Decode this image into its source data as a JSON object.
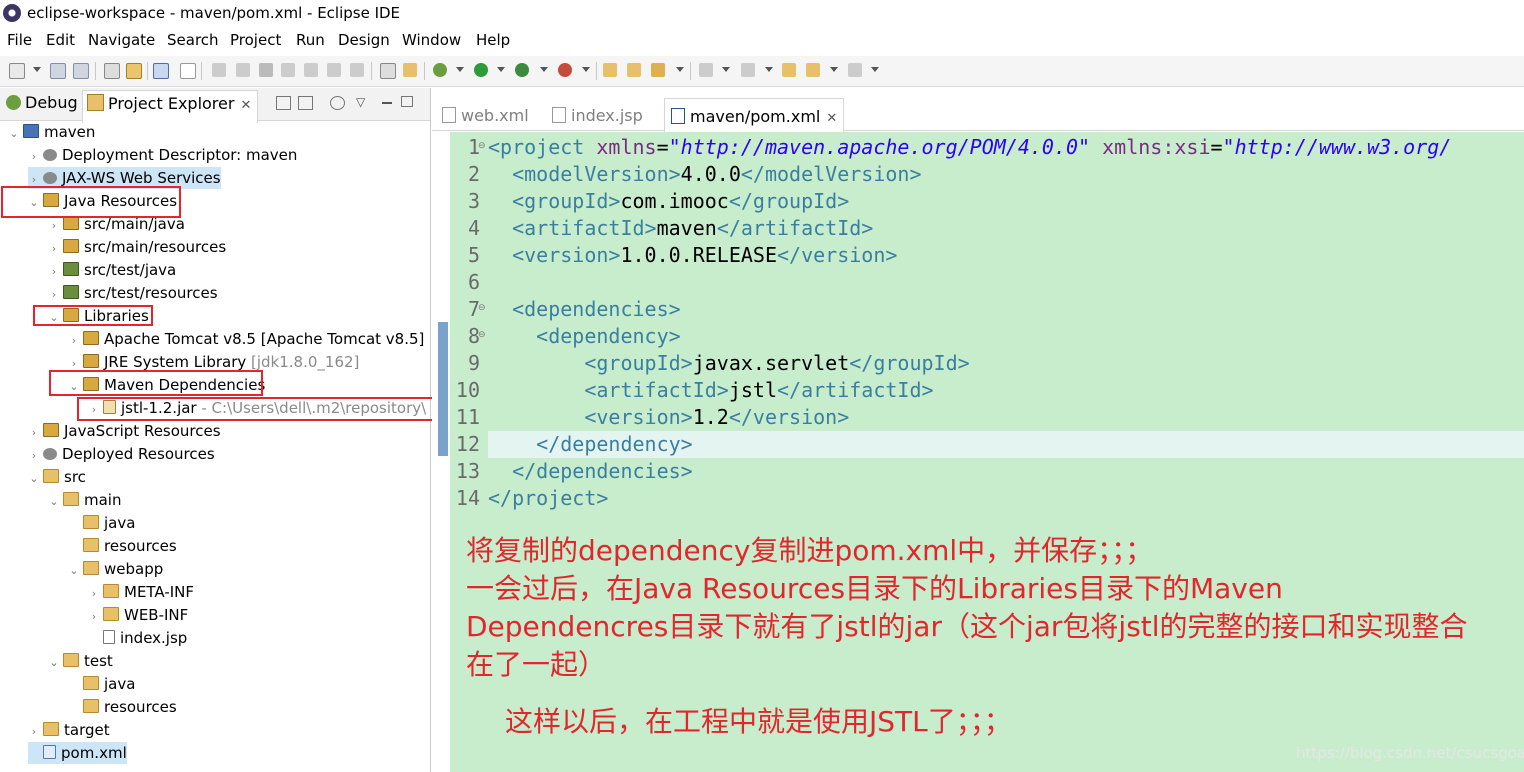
{
  "window": {
    "title": "eclipse-workspace - maven/pom.xml - Eclipse IDE"
  },
  "menu": [
    "File",
    "Edit",
    "Navigate",
    "Search",
    "Project",
    "Run",
    "Design",
    "Window",
    "Help"
  ],
  "left_tabs": {
    "debug": "Debug",
    "project_explorer": "Project Explorer"
  },
  "tree": [
    {
      "label": "maven",
      "muted": ""
    },
    {
      "label": "Deployment Descriptor: maven",
      "muted": ""
    },
    {
      "label": "JAX-WS Web Services",
      "muted": ""
    },
    {
      "label": "Java Resources",
      "muted": ""
    },
    {
      "label": "src/main/java",
      "muted": ""
    },
    {
      "label": "src/main/resources",
      "muted": ""
    },
    {
      "label": "src/test/java",
      "muted": ""
    },
    {
      "label": "src/test/resources",
      "muted": ""
    },
    {
      "label": "Libraries",
      "muted": ""
    },
    {
      "label": "Apache Tomcat v8.5 [Apache Tomcat v8.5]",
      "muted": ""
    },
    {
      "label": "JRE System Library ",
      "muted": "[jdk1.8.0_162]"
    },
    {
      "label": "Maven Dependencies",
      "muted": ""
    },
    {
      "label": "jstl-1.2.jar",
      "muted": " - C:\\Users\\dell\\.m2\\repository\\"
    },
    {
      "label": "JavaScript Resources",
      "muted": ""
    },
    {
      "label": "Deployed Resources",
      "muted": ""
    },
    {
      "label": "src",
      "muted": ""
    },
    {
      "label": "main",
      "muted": ""
    },
    {
      "label": "java",
      "muted": ""
    },
    {
      "label": "resources",
      "muted": ""
    },
    {
      "label": "webapp",
      "muted": ""
    },
    {
      "label": "META-INF",
      "muted": ""
    },
    {
      "label": "WEB-INF",
      "muted": ""
    },
    {
      "label": "index.jsp",
      "muted": ""
    },
    {
      "label": "test",
      "muted": ""
    },
    {
      "label": "java",
      "muted": ""
    },
    {
      "label": "resources",
      "muted": ""
    },
    {
      "label": "target",
      "muted": ""
    },
    {
      "label": "pom.xml",
      "muted": ""
    }
  ],
  "editor_tabs": [
    "web.xml",
    "index.jsp",
    "maven/pom.xml"
  ],
  "code_lines": [
    "1",
    "2",
    "3",
    "4",
    "5",
    "6",
    "7",
    "8",
    "9",
    "10",
    "11",
    "12",
    "13",
    "14"
  ],
  "code": {
    "l1_tag_open": "<project ",
    "l1_attr1": "xmlns",
    "l1_eq1": "=",
    "l1_val1": "\"http://maven.apache.org/POM/4.0.0\"",
    "l1_attr2": " xmlns:xsi",
    "l1_eq2": "=",
    "l1_val2": "\"http://www.w3.org/",
    "l2_open": "<modelVersion>",
    "l2_text": "4.0.0",
    "l2_close": "</modelVersion>",
    "l3_open": "<groupId>",
    "l3_text": "com.imooc",
    "l3_close": "</groupId>",
    "l4_open": "<artifactId>",
    "l4_text": "maven",
    "l4_close": "</artifactId>",
    "l5_open": "<version>",
    "l5_text": "1.0.0.RELEASE",
    "l5_close": "</version>",
    "l7": "<dependencies>",
    "l8": "<dependency>",
    "l9_open": "<groupId>",
    "l9_text": "javax.servlet",
    "l9_close": "</groupId>",
    "l10_open": "<artifactId>",
    "l10_text": "jstl",
    "l10_close": "</artifactId>",
    "l11_open": "<version>",
    "l11_text": "1.2",
    "l11_close": "</version>",
    "l12": "</dependency>",
    "l13": "</dependencies>",
    "l14": "</project>"
  },
  "annotation": {
    "line1": "将复制的dependency复制进pom.xml中，并保存；；；",
    "line2": "一会过后，在Java Resources目录下的Libraries目录下的Maven",
    "line3": "Dependencres目录下就有了jstl的jar（这个jar包将jstl的完整的接口和实现整合",
    "line4": "在了一起）",
    "line5": "这样以后，在工程中就是使用JSTL了；；；"
  },
  "watermark": "https://blog.csdn.net/csucsgoat",
  "colors": {
    "annotation": "#e3262d",
    "editor_bg": "#c7edcc",
    "tag": "#3b7fa0",
    "attr": "#7c2a83",
    "string": "#2a00ff"
  }
}
